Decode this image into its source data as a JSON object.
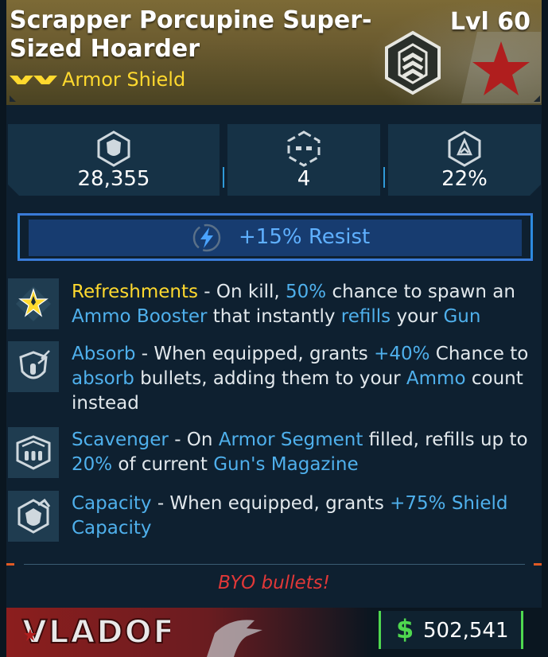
{
  "item": {
    "name": "Scrapper Porcupine Super-Sized Hoarder",
    "level": "Lvl 60",
    "type": "Armor Shield",
    "rarity_color": "#ffd92e"
  },
  "stats": [
    {
      "icon": "shield-capacity-icon",
      "value": "28,355"
    },
    {
      "icon": "armor-segment-icon",
      "value": "4"
    },
    {
      "icon": "recharge-rate-icon",
      "value": "22%"
    }
  ],
  "resist": {
    "icon": "shock-bolt-icon",
    "label": "+15% Resist",
    "color": "#5fb0ff"
  },
  "perks": [
    {
      "icon": "refreshments-star-icon",
      "name": "Refreshments"
    },
    {
      "icon": "absorb-shield-icon",
      "name": "Absorb"
    },
    {
      "icon": "scavenger-ammo-icon",
      "name": "Scavenger"
    },
    {
      "icon": "capacity-shield-icon",
      "name": "Capacity"
    }
  ],
  "perk_text": {
    "p0_a": " - On kill, ",
    "p0_b": "50%",
    "p0_c": " chance to spawn an ",
    "p0_d": "Ammo Booster",
    "p0_e": " that instantly ",
    "p0_f": "refills",
    "p0_g": " your ",
    "p0_h": "Gun",
    "p1_a": " - When equipped, grants ",
    "p1_b": "+40%",
    "p1_c": " Chance to ",
    "p1_d": "absorb",
    "p1_e": " bullets, adding them to your ",
    "p1_f": "Ammo",
    "p1_g": " count instead",
    "p2_a": " - On ",
    "p2_b": "Armor Segment",
    "p2_c": " filled, refills up to ",
    "p2_d": "20%",
    "p2_e": " of current ",
    "p2_f": "Gun's Magazine",
    "p3_a": " - When equipped, grants ",
    "p3_b": "+75% Shield Capacity"
  },
  "flavor_text": "BYO bullets!",
  "manufacturer": {
    "name": "VLADOF",
    "color": "#8c1e1e"
  },
  "price": {
    "currency_symbol": "$",
    "value": "502,541",
    "color": "#4fd84f"
  }
}
